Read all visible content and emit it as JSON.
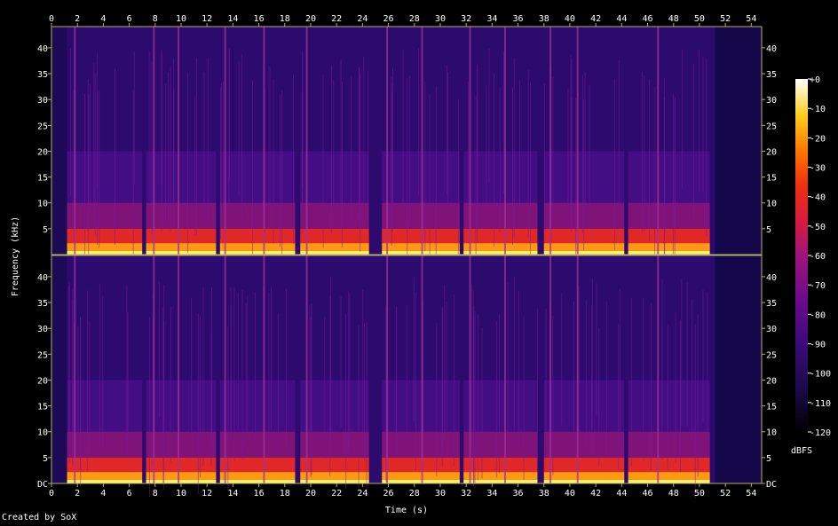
{
  "chart_data": {
    "type": "heatmap",
    "title": "",
    "xlabel": "Time (s)",
    "ylabel": "Frequency (kHz)",
    "xlim": [
      0,
      54.8
    ],
    "ylim": [
      0,
      44.1
    ],
    "x_ticks": [
      "0",
      "2",
      "4",
      "6",
      "8",
      "10",
      "12",
      "14",
      "16",
      "18",
      "20",
      "22",
      "24",
      "26",
      "28",
      "30",
      "32",
      "34",
      "36",
      "38",
      "40",
      "42",
      "44",
      "46",
      "48",
      "50",
      "52",
      "54"
    ],
    "y_ticks": [
      "DC",
      "5",
      "10",
      "15",
      "20",
      "25",
      "30",
      "35",
      "40"
    ],
    "channels": 2,
    "colorbar": {
      "label": "dBFS",
      "range": [
        -120,
        0
      ],
      "ticks": [
        "+0",
        "-10",
        "-20",
        "-30",
        "-40",
        "-50",
        "-60",
        "-70",
        "-80",
        "-90",
        "-100",
        "-110",
        "-120"
      ]
    },
    "segments_s": [
      [
        1.2,
        7.0
      ],
      [
        7.3,
        12.7
      ],
      [
        13.0,
        18.8
      ],
      [
        19.2,
        24.5
      ],
      [
        25.5,
        31.5
      ],
      [
        31.8,
        37.5
      ],
      [
        38.0,
        44.2
      ],
      [
        44.5,
        50.8
      ]
    ],
    "strong_onsets_s": [
      1.8,
      7.9,
      9.8,
      13.4,
      16.4,
      19.7,
      25.9,
      28.6,
      32.3,
      35.0,
      38.5,
      40.6,
      46.8
    ]
  },
  "colors": {
    "background": "#000000",
    "axis": "#b0b060",
    "text": "#ffffff"
  },
  "footer": {
    "text": "Created by SoX"
  }
}
